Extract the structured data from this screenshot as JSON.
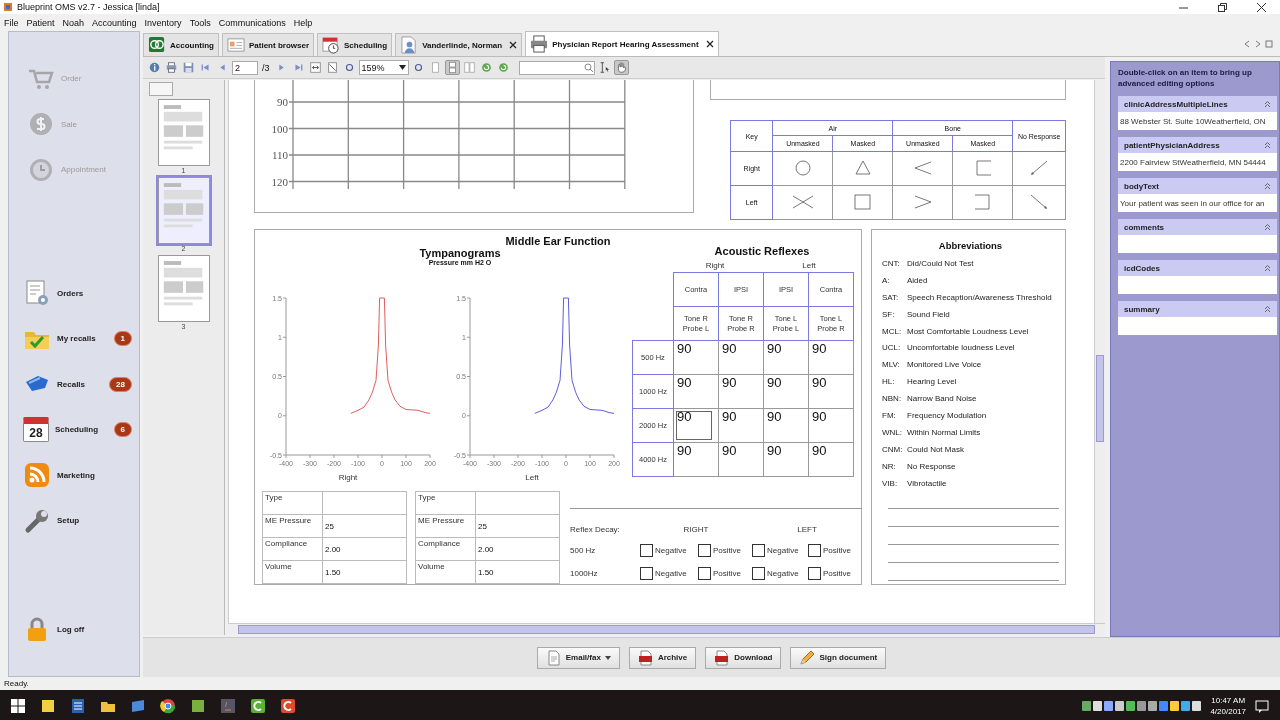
{
  "window": {
    "title": "Blueprint OMS v2.7 - Jessica [linda]"
  },
  "menu": [
    "File",
    "Patient",
    "Noah",
    "Accounting",
    "Inventory",
    "Tools",
    "Communications",
    "Help"
  ],
  "sidebar": {
    "groups": [
      {
        "items": [
          {
            "label": "Order",
            "disabled": true
          },
          {
            "label": "Sale",
            "disabled": true
          },
          {
            "label": "Appointment",
            "disabled": true
          }
        ]
      },
      {
        "items": [
          {
            "label": "Orders",
            "disabled": false
          },
          {
            "label": "My recalls",
            "disabled": false,
            "badge": "1"
          },
          {
            "label": "Recalls",
            "disabled": false,
            "badge": "28"
          },
          {
            "label": "Scheduling",
            "icon_text": "28",
            "disabled": false,
            "badge": "6"
          },
          {
            "label": "Marketing",
            "disabled": false
          },
          {
            "label": "Setup",
            "disabled": false
          }
        ]
      },
      {
        "items": [
          {
            "label": "Log off",
            "disabled": false
          }
        ]
      }
    ]
  },
  "tabs": [
    {
      "label": "Accounting",
      "selected": false,
      "closable": false
    },
    {
      "label": "Patient browser",
      "selected": false,
      "closable": false
    },
    {
      "label": "Scheduling",
      "selected": false,
      "closable": false
    },
    {
      "label": "Vanderlinde, Norman",
      "selected": false,
      "closable": true
    },
    {
      "label": "Physician Report Hearing Assessment",
      "selected": true,
      "closable": true
    }
  ],
  "toolbar": {
    "page": "2",
    "page_count": "/3",
    "zoom": "159%",
    "view_modes": [
      {
        "kind": "single",
        "selected": false
      },
      {
        "kind": "continuous",
        "selected": true
      },
      {
        "kind": "facing",
        "selected": false
      }
    ],
    "tools": [
      {
        "kind": "text-select",
        "selected": false
      },
      {
        "kind": "hand",
        "selected": true
      }
    ]
  },
  "thumbnails": [
    {
      "number": "1",
      "selected": false
    },
    {
      "number": "2",
      "selected": true
    },
    {
      "number": "3",
      "selected": false
    }
  ],
  "report": {
    "audiogram": {
      "y_labels": [
        "90",
        "100",
        "110",
        "120"
      ]
    },
    "key_table": {
      "title": "Key",
      "groups": [
        "Air",
        "Bone"
      ],
      "subheads": [
        "Unmasked",
        "Masked",
        "Unmasked",
        "Masked"
      ],
      "no_response": "No Response",
      "rows": [
        {
          "label": "Right"
        },
        {
          "label": "Left"
        }
      ]
    },
    "middle_ear": {
      "title": "Middle Ear Function",
      "tymp_title": "Tympanograms",
      "tymp_subtitle": "Pressure mm H2 O",
      "charts": [
        {
          "chart_data": {
            "type": "line",
            "xlabel": "Right",
            "x": [
              -130,
              -100,
              -75,
              -55,
              -40,
              -25,
              -15,
              -10,
              10,
              15,
              25,
              40,
              55,
              75,
              100,
              150,
              180,
              200
            ],
            "series": [
              {
                "color": "#e04a4a",
                "values": [
                  0.03,
                  0.07,
                  0.11,
                  0.2,
                  0.3,
                  0.45,
                  0.9,
                  1.5,
                  1.5,
                  0.9,
                  0.45,
                  0.3,
                  0.2,
                  0.12,
                  0.08,
                  0.07,
                  0.04,
                  0.03
                ]
              }
            ],
            "xlim": [
              -400,
              200
            ],
            "ylim": [
              -0.5,
              1.5
            ],
            "xticks": [
              -400,
              -300,
              -200,
              -100,
              0,
              100,
              200
            ],
            "yticks": [
              -0.5,
              0,
              0.5,
              1,
              1.5
            ]
          }
        },
        {
          "chart_data": {
            "type": "line",
            "xlabel": "Left",
            "x": [
              -130,
              -100,
              -75,
              -55,
              -40,
              -25,
              -15,
              -10,
              10,
              15,
              25,
              40,
              55,
              75,
              100,
              150,
              180,
              200
            ],
            "series": [
              {
                "color": "#4a4ae0",
                "values": [
                  0.03,
                  0.07,
                  0.11,
                  0.2,
                  0.3,
                  0.45,
                  0.9,
                  1.5,
                  1.5,
                  0.9,
                  0.45,
                  0.3,
                  0.2,
                  0.12,
                  0.08,
                  0.07,
                  0.04,
                  0.03
                ]
              }
            ],
            "xlim": [
              -400,
              200
            ],
            "ylim": [
              -0.5,
              1.5
            ],
            "xticks": [
              -400,
              -300,
              -200,
              -100,
              0,
              100,
              200
            ],
            "yticks": [
              -0.5,
              0,
              0.5,
              1,
              1.5
            ]
          }
        }
      ],
      "params": [
        {
          "rows": [
            {
              "label": "Type"
            },
            {
              "label": "ME Pressure",
              "value": "25"
            },
            {
              "label": "Compliance",
              "value": "2.00"
            },
            {
              "label": "Volume",
              "value": "1.50"
            }
          ]
        },
        {
          "rows": [
            {
              "label": "Type"
            },
            {
              "label": "ME Pressure",
              "value": "25"
            },
            {
              "label": "Compliance",
              "value": "2.00"
            },
            {
              "label": "Volume",
              "value": "1.50"
            }
          ]
        }
      ]
    },
    "reflexes": {
      "title": "Acoustic Reflexes",
      "sides": [
        "Right",
        "Left"
      ],
      "columns": [
        {
          "type": "Contra",
          "tone_probe": "Tone R Probe L"
        },
        {
          "type": "IPSI",
          "tone_probe": "Tone R Probe R"
        },
        {
          "type": "IPSI",
          "tone_probe": "Tone L Probe L"
        },
        {
          "type": "Contra",
          "tone_probe": "Tone L Probe R"
        }
      ],
      "rows": [
        {
          "freq": "500 Hz",
          "cells": [
            {
              "value": "90",
              "focused": false
            },
            {
              "value": "90",
              "focused": false
            },
            {
              "value": "90",
              "focused": false
            },
            {
              "value": "90",
              "focused": false
            }
          ]
        },
        {
          "freq": "1000 Hz",
          "cells": [
            {
              "value": "90",
              "focused": false
            },
            {
              "value": "90",
              "focused": false
            },
            {
              "value": "90",
              "focused": false
            },
            {
              "value": "90",
              "focused": false
            }
          ]
        },
        {
          "freq": "2000 Hz",
          "cells": [
            {
              "value": "90",
              "focused": true
            },
            {
              "value": "90",
              "focused": false
            },
            {
              "value": "90",
              "focused": false
            },
            {
              "value": "90",
              "focused": false
            }
          ]
        },
        {
          "freq": "4000 Hz",
          "cells": [
            {
              "value": "90",
              "focused": false
            },
            {
              "value": "90",
              "focused": false
            },
            {
              "value": "90",
              "focused": false
            },
            {
              "value": "90",
              "focused": false
            }
          ]
        }
      ]
    },
    "decay": {
      "title": "Reflex Decay:",
      "sides": [
        "RIGHT",
        "LEFT"
      ],
      "rows": [
        {
          "freq": "500 Hz",
          "options": [
            {
              "label": "Negative",
              "checked": false
            },
            {
              "label": "Positive",
              "checked": false
            },
            {
              "label": "Negative",
              "checked": false
            },
            {
              "label": "Positive",
              "checked": false
            }
          ]
        },
        {
          "freq": "1000Hz",
          "options": [
            {
              "label": "Negative",
              "checked": false
            },
            {
              "label": "Positive",
              "checked": false
            },
            {
              "label": "Negative",
              "checked": false
            },
            {
              "label": "Positive",
              "checked": false
            }
          ]
        }
      ]
    },
    "abbreviations": {
      "title": "Abbreviations",
      "items": [
        {
          "abbr": "CNT:",
          "meaning": "Did/Could Not Test"
        },
        {
          "abbr": "A:",
          "meaning": "Aided"
        },
        {
          "abbr": "SAT:",
          "meaning": "Speech Recaption/Awareness Threshold"
        },
        {
          "abbr": "SF:",
          "meaning": "Sound Field"
        },
        {
          "abbr": "MCL:",
          "meaning": "Most Comfortable Loudness Level"
        },
        {
          "abbr": "UCL:",
          "meaning": "Uncomfortable loudness Level"
        },
        {
          "abbr": "MLV:",
          "meaning": "Monitored Live Voice"
        },
        {
          "abbr": "HL:",
          "meaning": "Hearing Level"
        },
        {
          "abbr": "NBN:",
          "meaning": "Narrow Band Noise"
        },
        {
          "abbr": "FM:",
          "meaning": "Frequency Modulation"
        },
        {
          "abbr": "WNL:",
          "meaning": "Within Normal Limits"
        },
        {
          "abbr": "CNM:",
          "meaning": "Could Not Mask"
        },
        {
          "abbr": "NR:",
          "meaning": "No Response"
        },
        {
          "abbr": "VIB:",
          "meaning": "Vibrotactile"
        }
      ]
    }
  },
  "right_panel": {
    "hint": "Double-click on an item to bring up advanced editing options",
    "fields": [
      {
        "label": "clinicAddressMultipleLines",
        "value": "88 Webster St. Suite 10Weatherfield, ON"
      },
      {
        "label": "patientPhysicianAddress",
        "value": "2200 Fairview StWeatherfield, MN 54444"
      },
      {
        "label": "bodyText",
        "value": "Your patient was seen in our office for an"
      },
      {
        "label": "comments"
      },
      {
        "label": "icdCodes"
      },
      {
        "label": "summary"
      }
    ]
  },
  "buttons": [
    {
      "label": "Email/fax",
      "dropdown": true
    },
    {
      "label": "Archive",
      "dropdown": false
    },
    {
      "label": "Download",
      "dropdown": false
    },
    {
      "label": "Sign document",
      "dropdown": false
    }
  ],
  "status_bar": "Ready.",
  "taskbar": {
    "time": "10:47 AM",
    "date": "4/20/2017"
  }
}
